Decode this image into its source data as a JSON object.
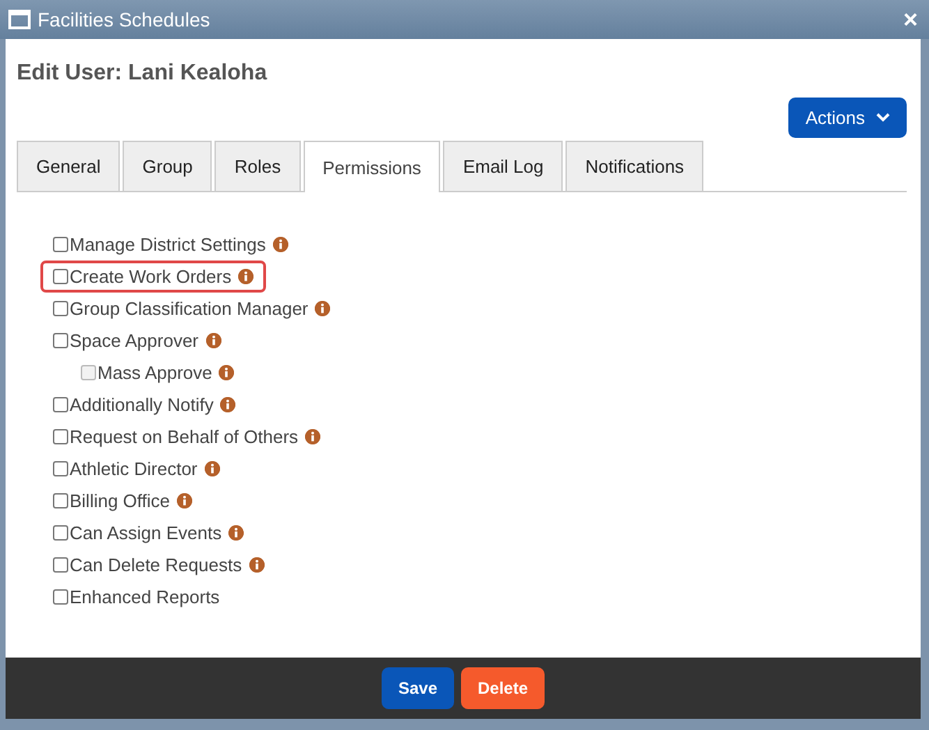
{
  "window": {
    "title": "Facilities Schedules",
    "close": "×"
  },
  "heading": "Edit User: Lani Kealoha",
  "actions_button": "Actions",
  "tabs": [
    {
      "label": "General",
      "selected": false
    },
    {
      "label": "Group",
      "selected": false
    },
    {
      "label": "Roles",
      "selected": false
    },
    {
      "label": "Permissions",
      "selected": true
    },
    {
      "label": "Email Log",
      "selected": false
    },
    {
      "label": "Notifications",
      "selected": false
    }
  ],
  "permissions": [
    {
      "label": "Manage District Settings",
      "checked": false,
      "disabled": false,
      "info": true,
      "highlighted": false
    },
    {
      "label": "Create Work Orders",
      "checked": false,
      "disabled": false,
      "info": true,
      "highlighted": true
    },
    {
      "label": "Group Classification Manager",
      "checked": false,
      "disabled": false,
      "info": true,
      "highlighted": false
    },
    {
      "label": "Space Approver",
      "checked": false,
      "disabled": false,
      "info": true,
      "highlighted": false,
      "children": [
        {
          "label": "Mass Approve",
          "checked": false,
          "disabled": true,
          "info": true,
          "highlighted": false
        }
      ]
    },
    {
      "label": "Additionally Notify",
      "checked": false,
      "disabled": false,
      "info": true,
      "highlighted": false
    },
    {
      "label": "Request on Behalf of Others",
      "checked": false,
      "disabled": false,
      "info": true,
      "highlighted": false
    },
    {
      "label": "Athletic Director",
      "checked": false,
      "disabled": false,
      "info": true,
      "highlighted": false
    },
    {
      "label": "Billing Office",
      "checked": false,
      "disabled": false,
      "info": true,
      "highlighted": false
    },
    {
      "label": "Can Assign Events",
      "checked": false,
      "disabled": false,
      "info": true,
      "highlighted": false
    },
    {
      "label": "Can Delete Requests",
      "checked": false,
      "disabled": false,
      "info": true,
      "highlighted": false
    },
    {
      "label": "Enhanced Reports",
      "checked": false,
      "disabled": false,
      "info": false,
      "highlighted": false
    }
  ],
  "footer_buttons": [
    {
      "label": "Save",
      "kind": "primary"
    },
    {
      "label": "Delete",
      "kind": "danger"
    }
  ]
}
